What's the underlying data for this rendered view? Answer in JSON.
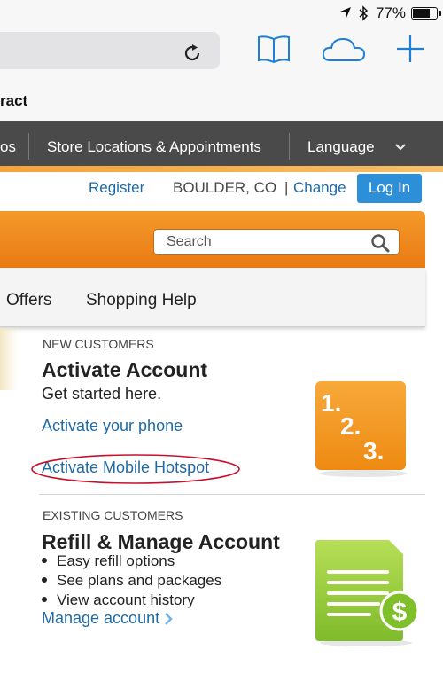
{
  "status_bar": {
    "battery_text": "77%",
    "battery_level": 0.77
  },
  "safari": {
    "tab_title": "ract"
  },
  "site_nav": {
    "items": [
      "os",
      "Store Locations & Appointments",
      "Language"
    ]
  },
  "utility": {
    "register": "Register",
    "location": "BOULDER, CO",
    "separator": "|",
    "change": "Change",
    "login": "Log In"
  },
  "search": {
    "placeholder": "Search"
  },
  "menu": {
    "offers": "Offers",
    "help": "Shopping Help"
  },
  "new_customers": {
    "label": "NEW CUSTOMERS",
    "title": "Activate Account",
    "desc": "Get started here.",
    "link_phone": "Activate your phone",
    "link_hotspot": "Activate Mobile Hotspot",
    "image_text": [
      "1.",
      "2.",
      "3."
    ]
  },
  "existing_customers": {
    "label": "EXISTING CUSTOMERS",
    "title": "Refill & Manage Account",
    "bullets": [
      "Easy refill options",
      "See plans and packages",
      "View account history"
    ],
    "link_manage": "Manage account",
    "image_symbol": "$"
  },
  "colors": {
    "link_blue": "#1f6aa5",
    "orange": "#f08a1f",
    "nav_gray": "#4a4a4a",
    "login_blue": "#2d8fd8",
    "annotation_red": "#c8102e",
    "green": "#8dc63f"
  }
}
